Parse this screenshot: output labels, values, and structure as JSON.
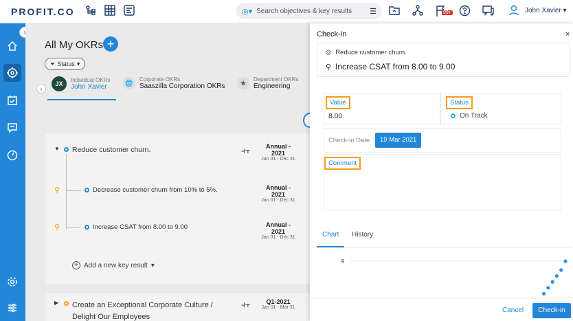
{
  "topbar": {
    "logo": "PROFIT.CO",
    "search_placeholder": "Search objectives & key results",
    "notification_badge": "99+",
    "user_name": "John Xavier"
  },
  "main": {
    "title": "All My OKRs",
    "status_filter": "Status",
    "tabs": [
      {
        "sub": "Individual OKRs",
        "name": "John Xavier",
        "avatar": "JX"
      },
      {
        "sub": "Corporate OKRs",
        "name": "Saaszilla Corporation OKRs"
      },
      {
        "sub": "Department OKRs",
        "name": "Engineering"
      }
    ],
    "objective1": {
      "title": "Reduce customer churn.",
      "period": "Annual -",
      "year": "2021",
      "range": "Jan 01 - Dec 31"
    },
    "kr1": {
      "title": "Decrease customer churn from 10% to 5%.",
      "period": "Annual -",
      "year": "2021",
      "range": "Jan 01 - Dec 31"
    },
    "kr2": {
      "title": "Increase CSAT from 8.00 to 9.00",
      "period": "Annual -",
      "year": "2021",
      "range": "Jan 01 - Dec 31"
    },
    "add_kr": "Add a new key result",
    "objective2": {
      "title_line1": "Create an Exceptional Corporate Culture /",
      "title_line2": "Delight Our Employees",
      "period": "Q1-2021",
      "range": "Jan 01 - Mar 31"
    }
  },
  "panel": {
    "title": "Check-in",
    "close": "×",
    "objective": "Reduce customer churn.",
    "key_result": "Increase CSAT from 8.00 to 9.00",
    "value_label": "Value",
    "value": "8.00",
    "status_label": "Status",
    "status_value": "On Track",
    "checkin_date_label": "Check-in Date",
    "checkin_date": "19 Mar 2021",
    "comment_label": "Comment",
    "tab_chart": "Chart",
    "tab_history": "History",
    "cancel": "Cancel",
    "checkin_button": "Check-in"
  },
  "chart_data": {
    "type": "scatter",
    "y_tick_labels": [
      "9"
    ],
    "x": [
      0.82,
      0.84,
      0.86,
      0.88,
      0.9,
      0.92,
      0.94,
      0.96,
      0.98,
      1.0
    ],
    "values": [
      8.05,
      8.15,
      8.25,
      8.35,
      8.45,
      8.55,
      8.65,
      8.75,
      8.85,
      9.0
    ],
    "ylim": [
      8.0,
      9.0
    ],
    "grid": true
  },
  "colors": {
    "accent": "#2386d8",
    "highlight": "#f59c16",
    "sidebar": "#2386d8"
  }
}
